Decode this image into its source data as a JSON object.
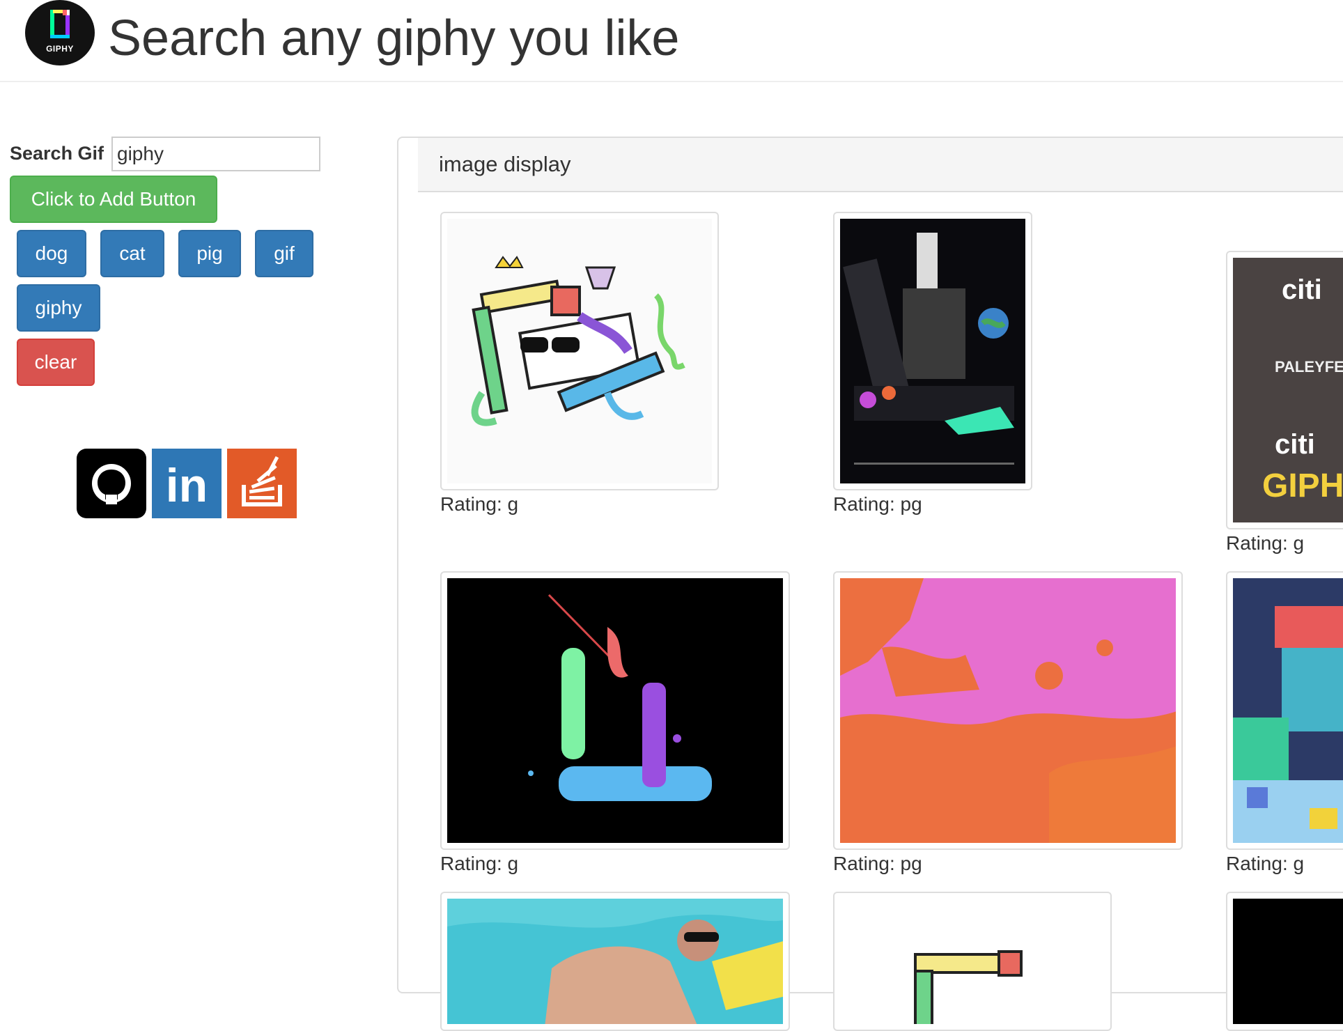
{
  "header": {
    "title": "Search any giphy you like",
    "logo_text": "GIPHY"
  },
  "search": {
    "label": "Search Gif",
    "value": "giphy"
  },
  "add_button": {
    "label": "Click to Add Button"
  },
  "topic_buttons": [
    {
      "label": "dog"
    },
    {
      "label": "cat"
    },
    {
      "label": "pig"
    },
    {
      "label": "gif"
    },
    {
      "label": "giphy"
    }
  ],
  "clear_button": {
    "label": "clear"
  },
  "social": {
    "github": "github-icon",
    "linkedin": "linkedin-icon",
    "stackoverflow": "stackoverflow-icon",
    "linkedin_text": "in"
  },
  "panel": {
    "title": "image display"
  },
  "gifs": [
    {
      "rating": "Rating: g"
    },
    {
      "rating": "Rating: pg"
    },
    {
      "rating": "Rating: g",
      "overlay_lines": [
        "citi",
        "PALEYFEST",
        "citi",
        "GIPHY"
      ]
    },
    {
      "rating": "Rating: g"
    },
    {
      "rating": "Rating: pg"
    },
    {
      "rating": "Rating: g"
    },
    {
      "rating": ""
    },
    {
      "rating": ""
    },
    {
      "rating": ""
    }
  ],
  "colors": {
    "success": "#5cb85c",
    "primary": "#337ab7",
    "danger": "#d9534f",
    "github": "#000000",
    "linkedin": "#2e77b5",
    "stackoverflow": "#e25a28"
  }
}
